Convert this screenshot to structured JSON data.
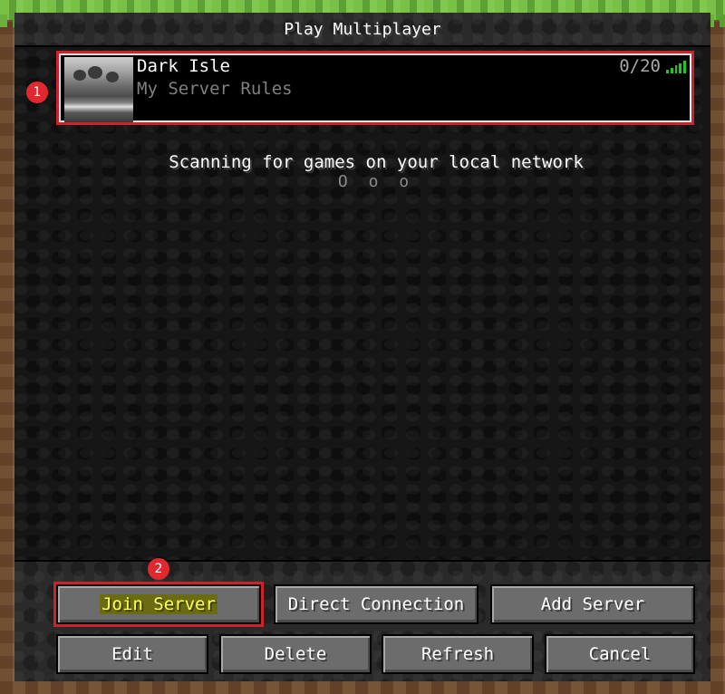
{
  "window": {
    "title": "Play Multiplayer"
  },
  "server_list": {
    "entries": [
      {
        "name": "Dark Isle",
        "motd": "My Server Rules",
        "players": "0/20",
        "ping_icon": "signal-bars-icon",
        "ping_color": "#1ec81e",
        "selected": true
      }
    ]
  },
  "lan": {
    "scanning_text": "Scanning for games on your local network",
    "dots": "O o o"
  },
  "annotations": {
    "badge_1": "1",
    "badge_2": "2",
    "highlight_color": "#d0202a"
  },
  "buttons": {
    "join_server": "Join Server",
    "direct_connection": "Direct Connection",
    "add_server": "Add Server",
    "edit": "Edit",
    "delete": "Delete",
    "refresh": "Refresh",
    "cancel": "Cancel"
  },
  "colors": {
    "join_text": "#ffff55",
    "button_text": "#ffffff",
    "motd_text": "#808080"
  }
}
